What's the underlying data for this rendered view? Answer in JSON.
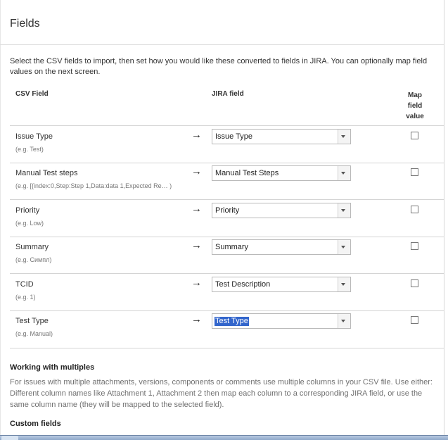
{
  "page": {
    "title": "Fields"
  },
  "intro": "Select the CSV fields to import, then set how you would like these converted to fields in JIRA. You can optionally map field values on the next screen.",
  "table": {
    "headers": {
      "csv": "CSV Field",
      "jira": "JIRA field",
      "map": "Map field value"
    },
    "arrow": "→",
    "rows": [
      {
        "name": "Issue Type",
        "example": "(e.g. Test)",
        "jira": "Issue Type",
        "map_checked": false
      },
      {
        "name": "Manual Test steps",
        "example": "(e.g. [{index:0,Step:Step 1,Data:data 1,Expected Re… )",
        "jira": "Manual Test Steps",
        "map_checked": false
      },
      {
        "name": "Priority",
        "example": "(e.g. Low)",
        "jira": "Priority",
        "map_checked": false
      },
      {
        "name": "Summary",
        "example": "(e.g. Симпл)",
        "jira": "Summary",
        "map_checked": false
      },
      {
        "name": "TCID",
        "example": "(e.g. 1)",
        "jira": "Test Description",
        "map_checked": false
      },
      {
        "name": "Test Type",
        "example": "(e.g. Manual)",
        "jira": "Test Type",
        "map_checked": false,
        "selected_text": true
      }
    ]
  },
  "multiples": {
    "title": "Working with multiples",
    "text": "For issues with multiple attachments, versions, components or comments use multiple columns in your CSV file. Use either: Different column names like Attachment 1, Attachment 2 then map each column to a corresponding JIRA field, or use the same column name (they will be mapped to the selected field)."
  },
  "custom": {
    "title": "Custom fields"
  },
  "colors": {
    "selection": "#3366cc",
    "muted_text": "#707070"
  }
}
